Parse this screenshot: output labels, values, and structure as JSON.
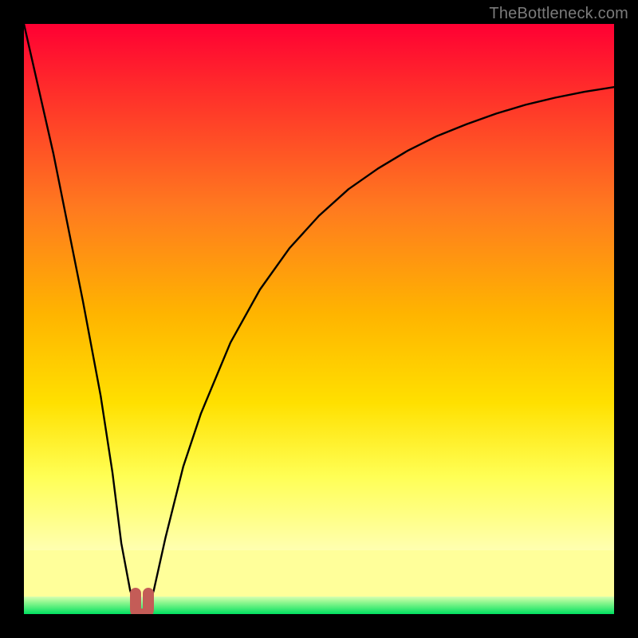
{
  "watermark": "TheBottleneck.com",
  "chart_data": {
    "type": "line",
    "title": "",
    "xlabel": "",
    "ylabel": "",
    "xlim": [
      0,
      100
    ],
    "ylim": [
      0,
      100
    ],
    "grid": false,
    "series": [
      {
        "name": "bottleneck-curve",
        "x": [
          0,
          5,
          10,
          13,
          15,
          16.5,
          18,
          19,
          19.5,
          20,
          20.5,
          21,
          22,
          24,
          27,
          30,
          35,
          40,
          45,
          50,
          55,
          60,
          65,
          70,
          75,
          80,
          85,
          90,
          95,
          100
        ],
        "y": [
          100,
          78,
          53,
          37,
          24,
          12,
          4,
          1,
          0,
          0,
          0,
          1,
          4,
          13,
          25,
          34,
          46,
          55,
          62,
          67.5,
          72,
          75.5,
          78.5,
          81,
          83,
          84.8,
          86.3,
          87.5,
          88.5,
          89.3
        ]
      }
    ],
    "marker": {
      "name": "optimal-point",
      "x": 20,
      "y": 0,
      "color": "#c45c57"
    },
    "background": {
      "gradient_top": "#ff0033",
      "gradient_mid": "#ffd500",
      "gradient_bottom": "#00ff66",
      "solid_band_color": "#ffff9a",
      "green_line_color": "#00e060"
    }
  }
}
